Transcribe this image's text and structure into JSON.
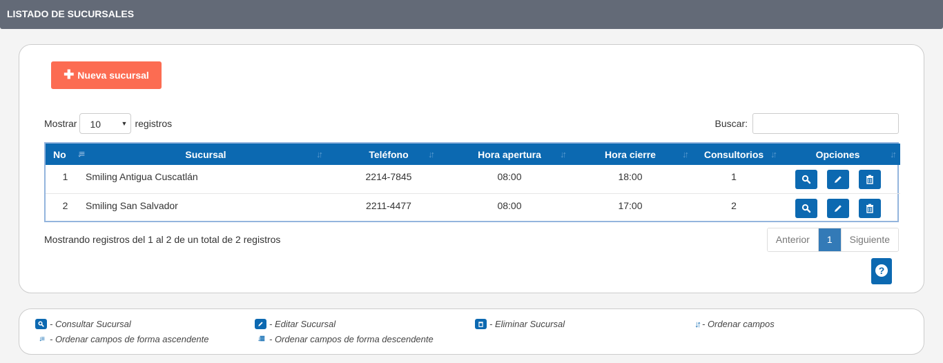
{
  "header": {
    "title": "LISTADO DE SUCURSALES"
  },
  "toolbar": {
    "new_label": "Nueva sucursal"
  },
  "length": {
    "prefix": "Mostrar",
    "value": "10",
    "suffix": "registros"
  },
  "search": {
    "label": "Buscar:",
    "value": ""
  },
  "table": {
    "columns": [
      "No",
      "Sucursal",
      "Teléfono",
      "Hora apertura",
      "Hora cierre",
      "Consultorios",
      "Opciones"
    ],
    "rows": [
      {
        "no": "1",
        "sucursal": "Smiling Antigua Cuscatlán",
        "telefono": "2214-7845",
        "apertura": "08:00",
        "cierre": "18:00",
        "consultorios": "1"
      },
      {
        "no": "2",
        "sucursal": "Smiling San Salvador",
        "telefono": "2211-4477",
        "apertura": "08:00",
        "cierre": "17:00",
        "consultorios": "2"
      }
    ]
  },
  "info": "Mostrando registros del 1 al 2 de un total de 2 registros",
  "pagination": {
    "prev": "Anterior",
    "current": "1",
    "next": "Siguiente"
  },
  "legend": {
    "view": "- Consultar Sucursal",
    "edit": "- Editar Sucursal",
    "delete": "- Eliminar Sucursal",
    "sort": "- Ordenar campos",
    "sort_asc": "- Ordenar campos de forma ascendente",
    "sort_desc": "- Ordenar campos de forma descendente"
  },
  "colors": {
    "header_bg": "#636a77",
    "primary": "#0c69b1",
    "accent": "#fc6c52",
    "page_active": "#337ab7"
  },
  "icons": [
    "plus-icon",
    "sort-icon",
    "sort-asc-icon",
    "sort-desc-icon",
    "search-icon",
    "pencil-icon",
    "trash-icon",
    "question-icon"
  ]
}
